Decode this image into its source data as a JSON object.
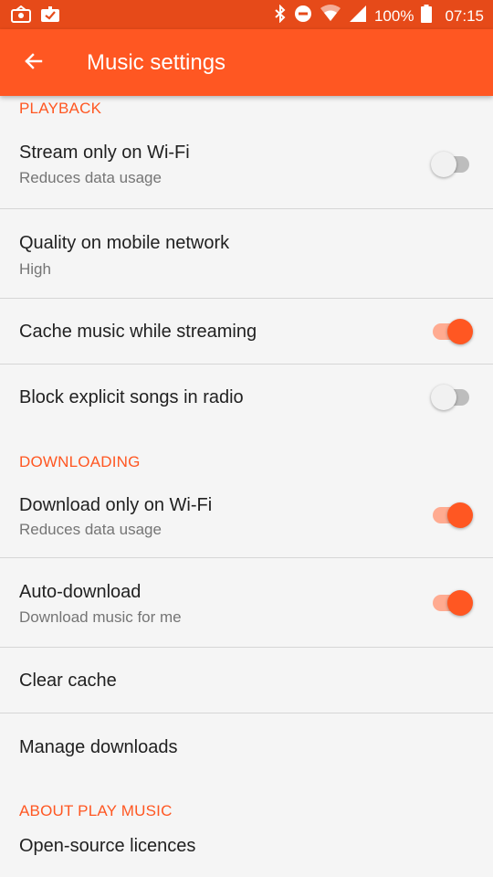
{
  "status_bar": {
    "battery_text": "100%",
    "time": "07:15"
  },
  "toolbar": {
    "title": "Music settings"
  },
  "sections": {
    "playback": "PLAYBACK",
    "downloading": "DOWNLOADING",
    "about": "ABOUT PLAY MUSIC"
  },
  "settings": {
    "stream_wifi": {
      "title": "Stream only on Wi-Fi",
      "subtitle": "Reduces data usage",
      "enabled": false
    },
    "quality": {
      "title": "Quality on mobile network",
      "subtitle": "High"
    },
    "cache": {
      "title": "Cache music while streaming",
      "enabled": true
    },
    "block_explicit": {
      "title": "Block explicit songs in radio",
      "enabled": false
    },
    "download_wifi": {
      "title": "Download only on Wi-Fi",
      "subtitle": "Reduces data usage",
      "enabled": true
    },
    "auto_download": {
      "title": "Auto-download",
      "subtitle": "Download music for me",
      "enabled": true
    },
    "clear_cache": {
      "title": "Clear cache"
    },
    "manage_downloads": {
      "title": "Manage downloads"
    },
    "licences": {
      "title": "Open-source licences"
    }
  },
  "colors": {
    "accent": "#ff5722",
    "status_bar": "#e64a19"
  }
}
